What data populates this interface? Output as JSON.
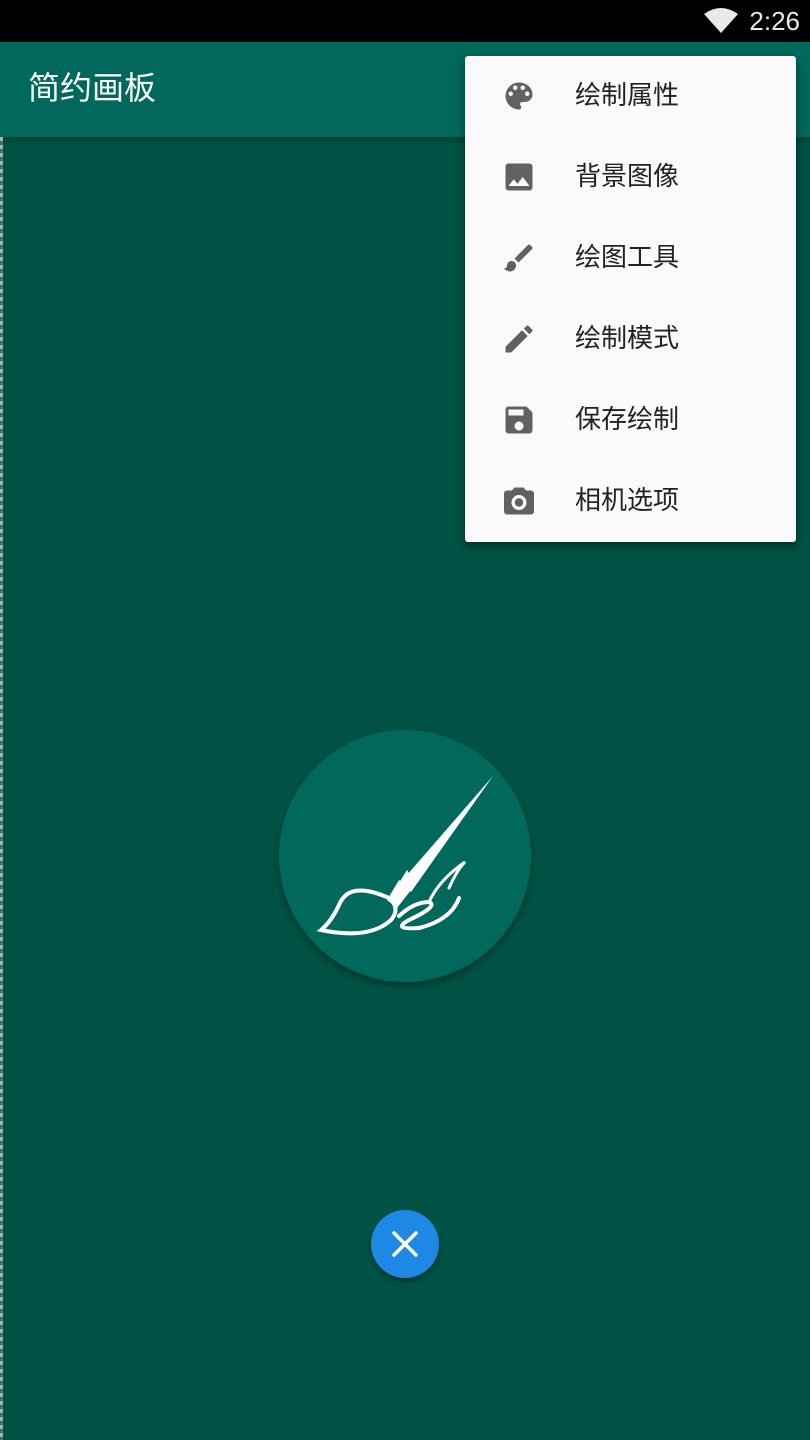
{
  "status_bar": {
    "time": "2:26",
    "wifi_icon": "wifi-icon"
  },
  "app_bar": {
    "title": "简约画板"
  },
  "menu": {
    "items": [
      {
        "label": "绘制属性",
        "icon": "palette-icon"
      },
      {
        "label": "背景图像",
        "icon": "image-icon"
      },
      {
        "label": "绘图工具",
        "icon": "brush-icon"
      },
      {
        "label": "绘制模式",
        "icon": "pencil-icon"
      },
      {
        "label": "保存绘制",
        "icon": "save-icon"
      },
      {
        "label": "相机选项",
        "icon": "camera-icon"
      }
    ]
  },
  "logo": {
    "icon": "paintbrush-logo-icon"
  },
  "fab": {
    "icon": "close-icon"
  },
  "colors": {
    "canvas": "#005344",
    "app_bar": "#00695c",
    "fab": "#1e88e5",
    "menu_bg": "#fafafa",
    "menu_icon": "#616161"
  }
}
